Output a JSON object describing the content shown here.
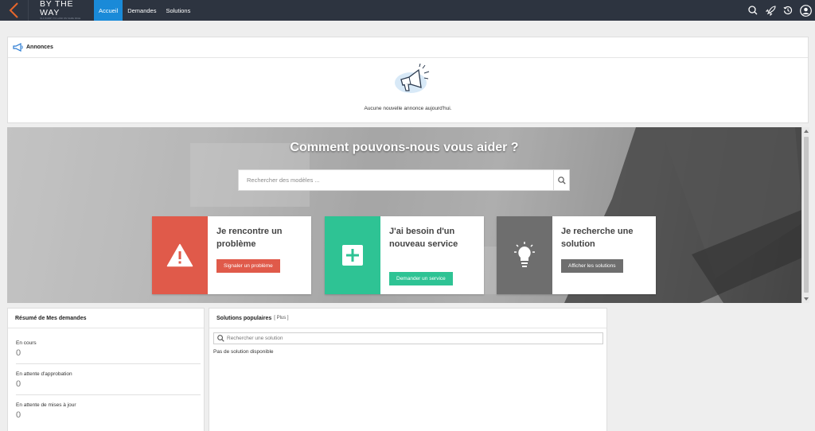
{
  "header": {
    "logo_main": "BY THE WAY",
    "logo_sub": "IN A HURRY TO LAND ON SAME PAGE",
    "tabs": [
      {
        "label": "Accueil",
        "active": true
      },
      {
        "label": "Demandes",
        "active": false
      },
      {
        "label": "Solutions",
        "active": false
      }
    ],
    "icons": [
      "search-icon",
      "rocket-icon",
      "history-icon",
      "user-avatar-icon"
    ],
    "accent_color": "#1a8ad8",
    "bar_color": "#2d3440"
  },
  "announcements": {
    "title": "Annonces",
    "empty_text": "Aucune nouvelle annonce aujourd'hui."
  },
  "hero": {
    "title": "Comment pouvons-nous vous aider ?",
    "search_placeholder": "Rechercher des modèles ..."
  },
  "cards": [
    {
      "title": "Je rencontre un problème",
      "button": "Signaler un problème",
      "icon": "warning-icon",
      "color": "#e05a4a"
    },
    {
      "title": "J'ai besoin d'un nouveau service",
      "button": "Demander un service",
      "icon": "plus-icon",
      "color": "#2ec394"
    },
    {
      "title": "Je recherche une solution",
      "button": "Afficher les solutions",
      "icon": "lightbulb-icon",
      "color": "#6e6e6e"
    }
  ],
  "summary": {
    "title": "Résumé de Mes demandes",
    "items": [
      {
        "label": "En cours",
        "value": "0"
      },
      {
        "label": "En attente d'approbation",
        "value": "0"
      },
      {
        "label": "En attente de mises à jour",
        "value": "0"
      }
    ]
  },
  "solutions": {
    "title": "Solutions populaires",
    "more_link": "[ Plus ]",
    "search_placeholder": "Rechercher une solution",
    "empty_text": "Pas de solution disponible"
  }
}
